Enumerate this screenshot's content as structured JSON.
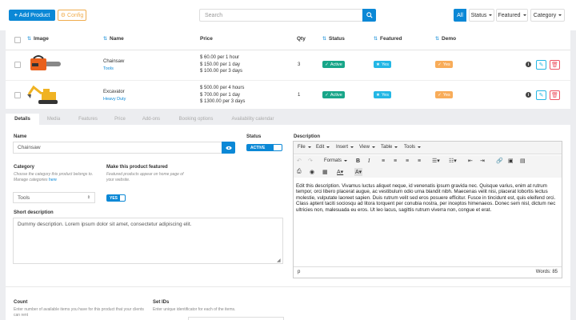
{
  "toolbar": {
    "add_product": "Add Product",
    "config": "Config",
    "search_placeholder": "Search",
    "filter_all": "All",
    "filter_status": "Status",
    "filter_featured": "Featured",
    "filter_category": "Category"
  },
  "table": {
    "headers": {
      "image": "Image",
      "name": "Name",
      "price": "Price",
      "qty": "Qty",
      "status": "Status",
      "featured": "Featured",
      "demo": "Demo"
    },
    "rows": [
      {
        "name": "Chainsaw",
        "category": "Tools",
        "price": [
          "$ 60.00 per 1 hour",
          "$ 150.00 per 1 day",
          "$ 100.00 per 3 days"
        ],
        "qty": "3",
        "status": "Active",
        "featured": "Yes",
        "demo": "Yes"
      },
      {
        "name": "Excavator",
        "category": "Heavy Duty",
        "price": [
          "$ 500.00 per 4 hours",
          "$ 700.00 per 1 day",
          "$ 1300.00 per 3 days"
        ],
        "qty": "1",
        "status": "Active",
        "featured": "Yes",
        "demo": "Yes"
      }
    ]
  },
  "tabs": [
    "Details",
    "Media",
    "Features",
    "Price",
    "Add-ons",
    "Booking options",
    "Availability calendar"
  ],
  "form": {
    "name_label": "Name",
    "name_value": "Chainsaw",
    "status_label": "Status",
    "status_value": "ACTIVE",
    "category_label": "Category",
    "category_help": "Choose the category this product belongs to.",
    "category_help2": "Manage categories",
    "category_link": "here",
    "category_value": "Tools",
    "featured_label": "Make this product featured",
    "featured_help": "Featured products appear on home page of your website.",
    "featured_value": "YES",
    "short_desc_label": "Short description",
    "short_desc_value": "Dummy description. Lorem ipsum dolor sit amet, consectetur adipiscing elit.",
    "description_label": "Description",
    "count_label": "Count",
    "count_help": "Enter number of available items you have for this product that your clients can rent",
    "setids_label": "Set IDs",
    "setids_help": "Enter unique identificator for each of the items."
  },
  "editor": {
    "menus": [
      "File",
      "Edit",
      "Insert",
      "View",
      "Table",
      "Tools"
    ],
    "formats": "Formats",
    "content": "Edit this description. Vivamus luctus aliquet neque, id venenatis ipsum gravida nec. Quisque varius, enim at rutrum tempor, orci libero placerat augue, ac vestibulum odio urna blandit nibh. Maecenas velit nisi, placerat lobortis lectus molestie, vulputate laoreet sapien. Duis rutrum velit sed eros posuere efficitur. Fusce in tincidunt est, quis eleifend orci. Class aptent taciti sociosqu ad litora torquent per conubia nostra, per inceptos himenaeos. Donec sem nisl, dictum nec ultricies non, malesuada eu eros. Ut leo lacus, sagittis rutrum viverra non, congue et erat.",
    "path": "p",
    "words": "Words: 85"
  },
  "colors": {
    "primary": "#0b88d6",
    "active": "#18a689",
    "featured": "#23b7e5",
    "demo": "#f8ac59"
  }
}
